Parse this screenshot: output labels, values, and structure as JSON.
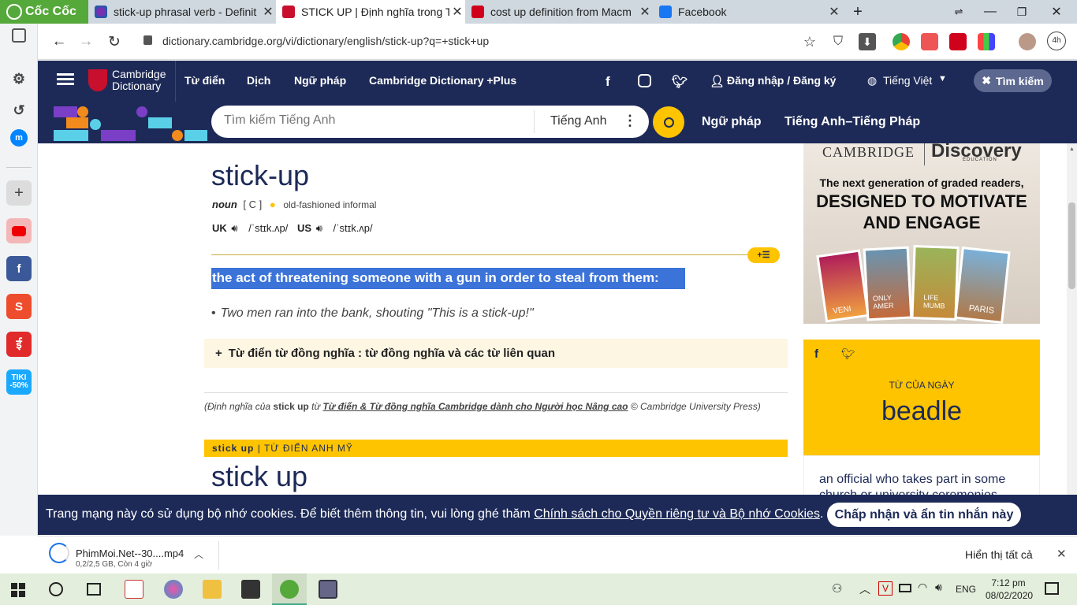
{
  "browser": {
    "brand": "Cốc Cốc",
    "tabs": [
      {
        "title": "stick-up phrasal verb - Definit",
        "active": false
      },
      {
        "title": "STICK UP | Định nghĩa trong T",
        "active": true
      },
      {
        "title": "cost up definition from Macm",
        "active": false
      },
      {
        "title": "Facebook",
        "active": false
      }
    ],
    "url": "dictionary.cambridge.org/vi/dictionary/english/stick-up?q=+stick+up",
    "ext_badge": "4h"
  },
  "site": {
    "logo": {
      "line1": "Cambridge",
      "line2": "Dictionary"
    },
    "nav": [
      "Từ điển",
      "Dịch",
      "Ngữ pháp",
      "Cambridge Dictionary +Plus"
    ],
    "login": "Đăng nhập / Đăng ký",
    "language": "Tiếng Việt",
    "search_button": "Tìm kiếm",
    "search_placeholder": "Tìm kiếm Tiếng Anh",
    "search_lang": "Tiếng Anh",
    "sub_links": [
      "Ngữ pháp",
      "Tiếng Anh–Tiếng Pháp"
    ]
  },
  "entry": {
    "headword": "stick-up",
    "pos": "noun",
    "grammar": "[ C ]",
    "usage": "old-fashioned informal",
    "uk_label": "UK",
    "uk_ipa": "/ˈstɪk.ʌp/",
    "us_label": "US",
    "us_ipa": "/ˈstɪk.ʌp/",
    "definition": "the act of threatening someone with a gun in order to steal from them:",
    "example": "Two men ran into the bank, shouting \"This is a stick-up!\"",
    "thesaurus": "Từ điển từ đồng nghĩa : từ đồng nghĩa và các từ liên quan",
    "credit_prefix": "(Định nghĩa của",
    "credit_word": "stick up",
    "credit_from": "từ",
    "credit_link": "Từ điển & Từ đồng nghĩa Cambridge dành cho Người học Nâng cao",
    "credit_suffix": "© Cambridge University Press)",
    "section_word": "stick up",
    "section_label": "| TỪ ĐIỂN ANH MỸ",
    "headword2": "stick up"
  },
  "ad": {
    "brand1": "CAMBRIDGE",
    "brand2": "Discovery",
    "brand2_sub": "EDUCATION",
    "line1": "The next generation of graded readers,",
    "line2": "DESIGNED TO MOTIVATE",
    "line3": "AND ENGAGE",
    "book_labels": [
      "VENI",
      "ONLY AMER",
      "LIFE MUMB",
      "PARIS"
    ]
  },
  "wotd": {
    "label": "TỪ CỦA NGÀY",
    "word": "beadle",
    "definition": "an official who takes part in some church or university ceremonies"
  },
  "cookie": {
    "text": "Trang mạng này có sử dụng bộ nhớ cookies. Để biết thêm thông tin, vui lòng ghé thăm",
    "link": "Chính sách cho Quyền riêng tư và Bộ nhớ Cookies",
    "end": ".",
    "button": "Chấp nhận và ẩn tin nhắn này"
  },
  "download": {
    "filename": "PhimMoi.Net--30....mp4",
    "status": "0,2/2,5 GB, Còn 4 giờ",
    "show_all": "Hiển thị tất cả"
  },
  "taskbar": {
    "lang": "ENG",
    "time": "7:12 pm",
    "date": "08/02/2020"
  },
  "colors": {
    "navy": "#1d2a57",
    "yellow": "#fec400",
    "highlight": "#3b73d9",
    "brand_green": "#55a83a"
  }
}
